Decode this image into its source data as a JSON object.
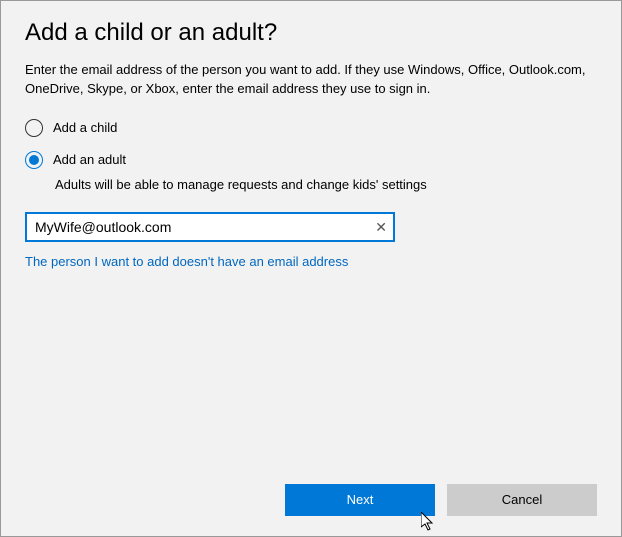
{
  "title": "Add a child or an adult?",
  "description": "Enter the email address of the person you want to add. If they use Windows, Office, Outlook.com, OneDrive, Skype, or Xbox, enter the email address they use to sign in.",
  "options": {
    "child": {
      "label": "Add a child",
      "selected": false
    },
    "adult": {
      "label": "Add an adult",
      "selected": true,
      "hint": "Adults will be able to manage requests and change kids' settings"
    }
  },
  "email": {
    "value": "MyWife@outlook.com"
  },
  "link": {
    "no_email": "The person I want to add doesn't have an email address"
  },
  "buttons": {
    "next": "Next",
    "cancel": "Cancel"
  }
}
